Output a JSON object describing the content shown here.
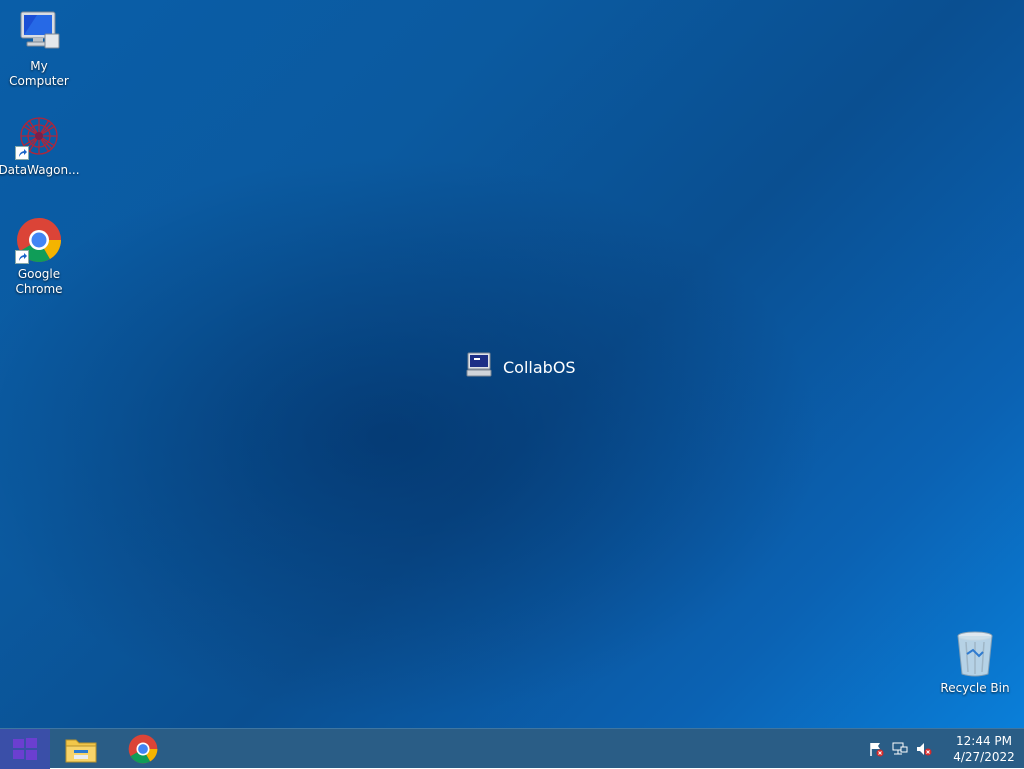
{
  "desktop": {
    "icons": [
      {
        "label": "My Computer",
        "icon": "my-computer-icon"
      },
      {
        "label": "DataWagon...",
        "icon": "datawagon-icon"
      },
      {
        "label": "Google Chrome",
        "label_line1": "Google",
        "label_line2": "Chrome",
        "icon": "chrome-icon"
      },
      {
        "label": "Recycle Bin",
        "icon": "recycle-bin-icon"
      }
    ],
    "center_label": "CollabOS"
  },
  "taskbar": {
    "apps": [
      {
        "name": "File Explorer",
        "icon": "folder-icon"
      },
      {
        "name": "Google Chrome",
        "icon": "chrome-icon"
      }
    ],
    "tray": {
      "icons": [
        "action-center-flag-icon",
        "network-icon",
        "volume-muted-icon"
      ],
      "time": "12:44 PM",
      "date": "4/27/2022"
    }
  },
  "colors": {
    "taskbar": "#2a5d86",
    "start_button": "#3a4fa8",
    "wallpaper": "#0b5aa0"
  }
}
